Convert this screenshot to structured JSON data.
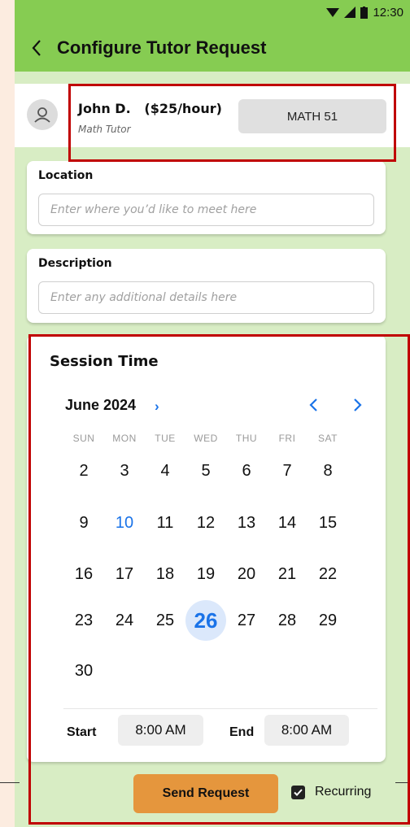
{
  "status_bar": {
    "time": "12:30"
  },
  "app_bar": {
    "title": "Configure Tutor Request"
  },
  "tutor": {
    "name": "John D.",
    "rate": "($25/hour)",
    "role": "Math Tutor",
    "course": "MATH 51"
  },
  "location": {
    "label": "Location",
    "placeholder": "Enter where you’d like to meet here"
  },
  "description": {
    "label": "Description",
    "placeholder": "Enter any additional details here"
  },
  "session": {
    "title": "Session Time",
    "month": "June 2024",
    "weekdays": [
      "SUN",
      "MON",
      "TUE",
      "WED",
      "THU",
      "FRI",
      "SAT"
    ],
    "weeks": [
      [
        "2",
        "3",
        "4",
        "5",
        "6",
        "7",
        "8"
      ],
      [
        "9",
        "10",
        "11",
        "12",
        "13",
        "14",
        "15"
      ],
      [
        "16",
        "17",
        "18",
        "19",
        "20",
        "21",
        "22"
      ],
      [
        "23",
        "24",
        "25",
        "26",
        "27",
        "28",
        "29"
      ],
      [
        "30"
      ]
    ],
    "today": "10",
    "selected": "26",
    "start_label": "Start",
    "start_time": "8:00 AM",
    "end_label": "End",
    "end_time": "8:00 AM"
  },
  "actions": {
    "send_label": "Send Request",
    "recurring_label": "Recurring",
    "recurring_checked": true
  },
  "colors": {
    "app_bar": "#86cc52",
    "background": "#d8edc4",
    "accent_button": "#e5963d",
    "link_blue": "#1a73e8",
    "annotation_red": "#c00000"
  }
}
